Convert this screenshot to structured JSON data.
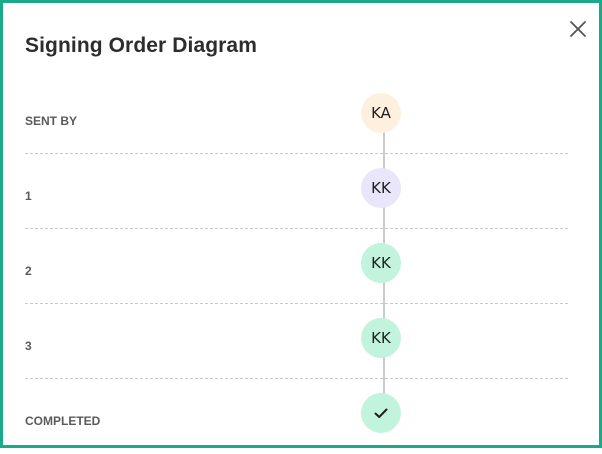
{
  "dialog": {
    "title": "Signing Order Diagram",
    "close_icon": "close-icon"
  },
  "rows": [
    {
      "label": "SENT BY",
      "initials": "KA",
      "color": "#fdf0df",
      "icon": null
    },
    {
      "label": "1",
      "initials": "KK",
      "color": "#e9e5fb",
      "icon": null
    },
    {
      "label": "2",
      "initials": "KK",
      "color": "#c2f3dc",
      "icon": null
    },
    {
      "label": "3",
      "initials": "KK",
      "color": "#c2f3dc",
      "icon": null
    },
    {
      "label": "COMPLETED",
      "initials": "",
      "color": "#c2f3dc",
      "icon": "checkmark-icon"
    }
  ],
  "colors": {
    "accent_border": "#1aa98a",
    "connector": "#c8ccd0"
  }
}
